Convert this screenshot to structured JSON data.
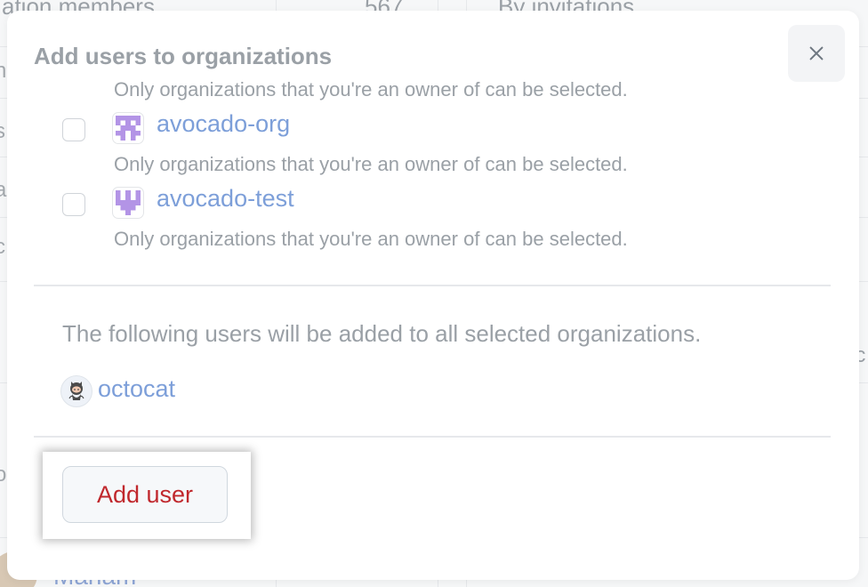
{
  "background": {
    "top_text_left": "ation members",
    "top_count": "567",
    "top_text_right": "By invitations",
    "person_name": "Mariam",
    "left_edge_letters": [
      "n",
      "s",
      "a",
      "c",
      "o"
    ],
    "right_edge_letter": "ic"
  },
  "dialog": {
    "title": "Add users to organizations",
    "close_label": "Close",
    "owner_hint": "Only organizations that you're an owner of can be selected.",
    "organizations": [
      {
        "name": "avocado-org",
        "checked": false,
        "avatar_icon": "identicon-org-icon",
        "hint": "Only organizations that you're an owner of can be selected."
      },
      {
        "name": "avocado-test",
        "checked": false,
        "avatar_icon": "identicon-test-icon",
        "hint": "Only organizations that you're an owner of can be selected."
      }
    ],
    "users_note": "The following users will be added to all selected organizations.",
    "users": [
      {
        "login": "octocat",
        "avatar_icon": "octocat-avatar-icon"
      }
    ],
    "submit_label": "Add user"
  },
  "colors": {
    "link": "#7d9fd9",
    "danger_text": "#c0282d",
    "identicon": "#b394e6",
    "muted_text": "#9aa0a6"
  }
}
